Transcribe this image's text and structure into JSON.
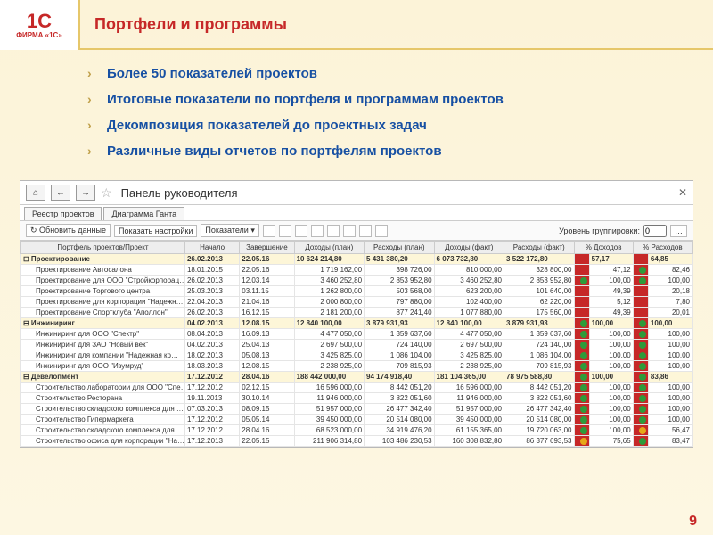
{
  "logo": {
    "main": "1С",
    "sub": "ФИРМА «1С»"
  },
  "title": "Портфели и программы",
  "bullets": [
    "Более 50 показателей проектов",
    "Итоговые показатели по портфеля и программам проектов",
    "Декомпозиция показателей до проектных задач",
    "Различные виды отчетов по портфелям проектов"
  ],
  "app": {
    "title": "Панель руководителя",
    "tabs": [
      "Реестр проектов",
      "Диаграмма Ганта"
    ],
    "toolbar": {
      "refresh": "Обновить данные",
      "settings": "Показать настройки",
      "indicators": "Показатели",
      "level_label": "Уровень группировки:",
      "level_value": "0"
    },
    "columns": [
      "Портфель проектов/Проект",
      "Начало",
      "Завершение",
      "Доходы (план)",
      "Расходы (план)",
      "Доходы (факт)",
      "Расходы (факт)",
      "% Доходов",
      "% Расходов"
    ],
    "groups": [
      {
        "name": "Проектирование",
        "start": "26.02.2013",
        "end": "22.05.16",
        "dp": "10 624 214,80",
        "rp": "5 431 380,20",
        "df": "6 073 732,80",
        "rf": "3 522 172,80",
        "pd": "57,17",
        "pr": "64,85",
        "i1": "r",
        "i2": "r",
        "rows": [
          {
            "name": "Проектирование Автосалона",
            "start": "18.01.2015",
            "end": "22.05.16",
            "dp": "1 719 162,00",
            "rp": "398 726,00",
            "df": "810 000,00",
            "rf": "328 800,00",
            "pd": "47,12",
            "pr": "82,46",
            "i1": "r",
            "i2": "g"
          },
          {
            "name": "Проектирование для ООО \"Стройкорпорац…",
            "start": "26.02.2013",
            "end": "12.03.14",
            "dp": "3 460 252,80",
            "rp": "2 853 952,80",
            "df": "3 460 252,80",
            "rf": "2 853 952,80",
            "pd": "100,00",
            "pr": "100,00",
            "i1": "g",
            "i2": "g"
          },
          {
            "name": "Проектирование Торгового центра",
            "start": "25.03.2013",
            "end": "03.11.15",
            "dp": "1 262 800,00",
            "rp": "503 568,00",
            "df": "623 200,00",
            "rf": "101 640,00",
            "pd": "49,39",
            "pr": "20,18",
            "i1": "r",
            "i2": "r"
          },
          {
            "name": "Проектирование для корпорации \"Надежн…",
            "start": "22.04.2013",
            "end": "21.04.16",
            "dp": "2 000 800,00",
            "rp": "797 880,00",
            "df": "102 400,00",
            "rf": "62 220,00",
            "pd": "5,12",
            "pr": "7,80",
            "i1": "r",
            "i2": "r"
          },
          {
            "name": "Проектирование Спортклуба \"Аполлон\"",
            "start": "26.02.2013",
            "end": "16.12.15",
            "dp": "2 181 200,00",
            "rp": "877 241,40",
            "df": "1 077 880,00",
            "rf": "175 560,00",
            "pd": "49,39",
            "pr": "20,01",
            "i1": "r",
            "i2": "r"
          }
        ]
      },
      {
        "name": "Инжиниринг",
        "start": "04.02.2013",
        "end": "12.08.15",
        "dp": "12 840 100,00",
        "rp": "3 879 931,93",
        "df": "12 840 100,00",
        "rf": "3 879 931,93",
        "pd": "100,00",
        "pr": "100,00",
        "i1": "g",
        "i2": "g",
        "rows": [
          {
            "name": "Инжиниринг для ООО \"Спектр\"",
            "start": "08.04.2013",
            "end": "16.09.13",
            "dp": "4 477 050,00",
            "rp": "1 359 637,60",
            "df": "4 477 050,00",
            "rf": "1 359 637,60",
            "pd": "100,00",
            "pr": "100,00",
            "i1": "g",
            "i2": "g"
          },
          {
            "name": "Инжиниринг для ЗАО \"Новый век\"",
            "start": "04.02.2013",
            "end": "25.04.13",
            "dp": "2 697 500,00",
            "rp": "724 140,00",
            "df": "2 697 500,00",
            "rf": "724 140,00",
            "pd": "100,00",
            "pr": "100,00",
            "i1": "g",
            "i2": "g"
          },
          {
            "name": "Инжиниринг для компании \"Надежная кр…",
            "start": "18.02.2013",
            "end": "05.08.13",
            "dp": "3 425 825,00",
            "rp": "1 086 104,00",
            "df": "3 425 825,00",
            "rf": "1 086 104,00",
            "pd": "100,00",
            "pr": "100,00",
            "i1": "g",
            "i2": "g"
          },
          {
            "name": "Инжиниринг для ООО \"Изумруд\"",
            "start": "18.03.2013",
            "end": "12.08.15",
            "dp": "2 238 925,00",
            "rp": "709 815,93",
            "df": "2 238 925,00",
            "rf": "709 815,93",
            "pd": "100,00",
            "pr": "100,00",
            "i1": "g",
            "i2": "g"
          }
        ]
      },
      {
        "name": "Девелопмент",
        "start": "17.12.2012",
        "end": "28.04.16",
        "dp": "188 442 000,00",
        "rp": "94 174 918,40",
        "df": "181 104 365,00",
        "rf": "78 975 588,80",
        "pd": "100,00",
        "pr": "83,86",
        "i1": "g",
        "i2": "g",
        "rows": [
          {
            "name": "Строительство лаборатории для ООО \"Спе…",
            "start": "17.12.2012",
            "end": "02.12.15",
            "dp": "16 596 000,00",
            "rp": "8 442 051,20",
            "df": "16 596 000,00",
            "rf": "8 442 051,20",
            "pd": "100,00",
            "pr": "100,00",
            "i1": "g",
            "i2": "g"
          },
          {
            "name": "Строительство Ресторана",
            "start": "19.11.2013",
            "end": "30.10.14",
            "dp": "11 946 000,00",
            "rp": "3 822 051,60",
            "df": "11 946 000,00",
            "rf": "3 822 051,60",
            "pd": "100,00",
            "pr": "100,00",
            "i1": "g",
            "i2": "g"
          },
          {
            "name": "Строительство складского комплекса для …",
            "start": "07.03.2013",
            "end": "08.09.15",
            "dp": "51 957 000,00",
            "rp": "26 477 342,40",
            "df": "51 957 000,00",
            "rf": "26 477 342,40",
            "pd": "100,00",
            "pr": "100,00",
            "i1": "g",
            "i2": "g"
          },
          {
            "name": "Строительство Гипермаркета",
            "start": "17.12.2012",
            "end": "05.05.14",
            "dp": "39 450 000,00",
            "rp": "20 514 080,00",
            "df": "39 450 000,00",
            "rf": "20 514 080,00",
            "pd": "100,00",
            "pr": "100,00",
            "i1": "g",
            "i2": "g"
          },
          {
            "name": "Строительство складского комплекса для …",
            "start": "17.12.2012",
            "end": "28.04.16",
            "dp": "68 523 000,00",
            "rp": "34 919 476,20",
            "df": "61 155 365,00",
            "rf": "19 720 063,00",
            "pd": "100,00",
            "pr": "56,47",
            "i1": "g",
            "i2": "y"
          },
          {
            "name": "Строительство офиса для корпорации \"На…",
            "start": "17.12.2013",
            "end": "22.05.15",
            "dp": "211 906 314,80",
            "rp": "103 486 230,53",
            "df": "160 308 832,80",
            "rf": "86 377 693,53",
            "pd": "75,65",
            "pr": "83,47",
            "i1": "y",
            "i2": "g"
          }
        ]
      }
    ]
  },
  "page_number": "9"
}
